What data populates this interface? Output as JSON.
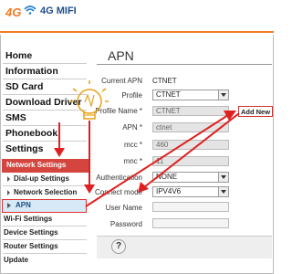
{
  "header": {
    "logo_4g": "4G",
    "brand": "4G MIFI",
    "wifi_icon": "wifi-icon",
    "accent": "#f47b20"
  },
  "sidebar": {
    "items": [
      {
        "label": "Home"
      },
      {
        "label": "Information"
      },
      {
        "label": "SD Card"
      },
      {
        "label": "Download Driver"
      },
      {
        "label": "SMS"
      },
      {
        "label": "Phonebook"
      },
      {
        "label": "Settings"
      }
    ],
    "network_settings": "Network Settings",
    "sub_items": [
      {
        "label": "Dial-up Settings"
      },
      {
        "label": "Network Selection"
      },
      {
        "label": "APN"
      }
    ],
    "bottom_items": [
      {
        "label": "Wi-Fi Settings"
      },
      {
        "label": "Device Settings"
      },
      {
        "label": "Router Settings"
      },
      {
        "label": "Update"
      }
    ]
  },
  "main": {
    "title": "APN",
    "current_apn_label": "Current APN",
    "current_apn_value": "CTNET",
    "profile_label": "Profile",
    "profile_value": "CTNET",
    "profile_name_label": "Profile Name *",
    "profile_name_value": "CTNET",
    "add_new_label": "Add New",
    "apn_label": "APN *",
    "apn_value": "ctnet",
    "mcc_label": "mcc *",
    "mcc_value": "460",
    "mnc_label": "mnc *",
    "mnc_value": "11",
    "auth_label": "Authentication",
    "auth_value": "NONE",
    "connect_mode_label": "Connect mode",
    "connect_mode_value": "IPV4V6",
    "user_name_label": "User Name",
    "user_name_value": "",
    "password_label": "Password",
    "password_value": "",
    "help_glyph": "?"
  },
  "annotations": {
    "arrow_color": "#e02020",
    "bulb_icon": "lightbulb-icon"
  }
}
